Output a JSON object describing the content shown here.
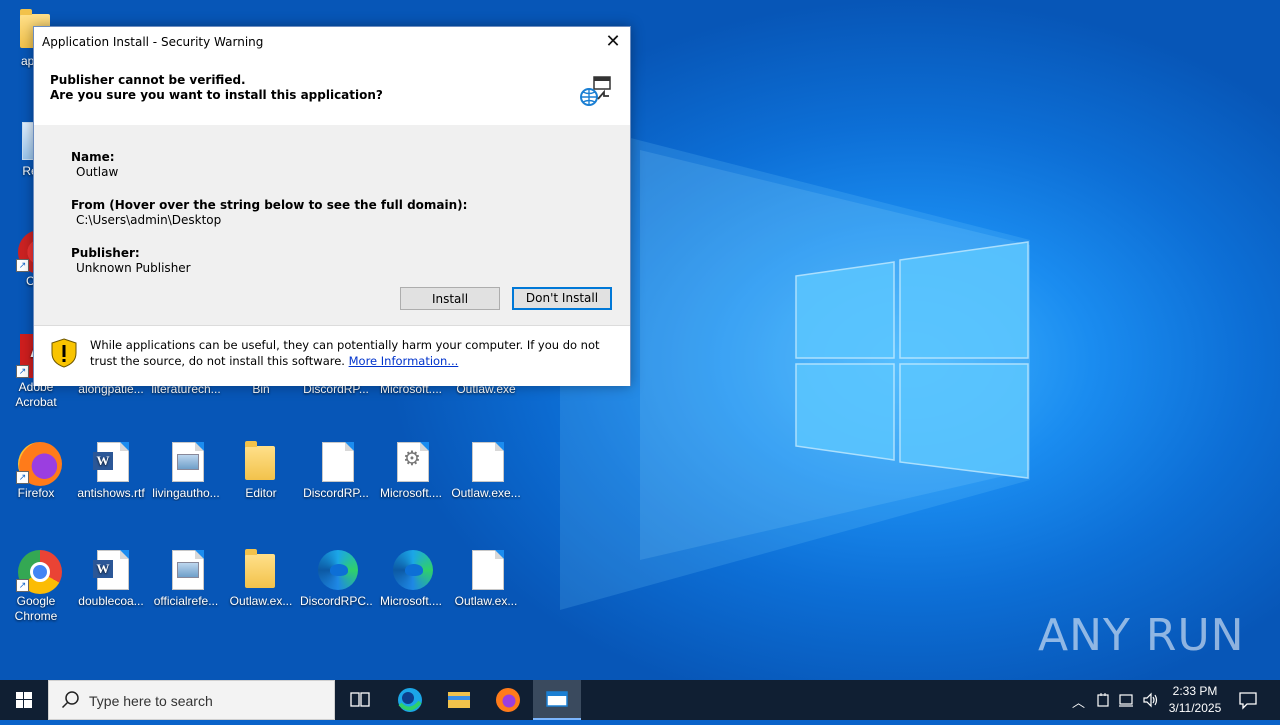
{
  "desktop": {
    "icons": [
      {
        "label": "app.p"
      },
      {
        "label": "Recy"
      },
      {
        "label": "CCl"
      },
      {
        "label": "Adobe Acrobat"
      },
      {
        "label": "alongpatie..."
      },
      {
        "label": "literaturech..."
      },
      {
        "label": "Bin"
      },
      {
        "label": "DiscordRP..."
      },
      {
        "label": "Microsoft...."
      },
      {
        "label": "Outlaw.exe"
      },
      {
        "label": "Firefox"
      },
      {
        "label": "antishows.rtf"
      },
      {
        "label": "livingautho..."
      },
      {
        "label": "Editor"
      },
      {
        "label": "DiscordRP..."
      },
      {
        "label": "Microsoft...."
      },
      {
        "label": "Outlaw.exe..."
      },
      {
        "label": "Google Chrome"
      },
      {
        "label": "doublecoa..."
      },
      {
        "label": "officialrefe..."
      },
      {
        "label": "Outlaw.ex..."
      },
      {
        "label": "DiscordRPC..."
      },
      {
        "label": "Microsoft...."
      },
      {
        "label": "Outlaw.ex..."
      }
    ],
    "watermark": "ANY RUN"
  },
  "dialog": {
    "title": "Application Install - Security Warning",
    "heading1": "Publisher cannot be verified.",
    "heading2": "Are you sure you want to install this application?",
    "name_label": "Name:",
    "name_value": "Outlaw",
    "from_label": "From (Hover over the string below to see the full domain):",
    "from_value": "C:\\Users\\admin\\Desktop",
    "publisher_label": "Publisher:",
    "publisher_value": "Unknown Publisher",
    "install_label": "Install",
    "dont_install_label": "Don't Install",
    "warning_text": "While applications can be useful, they can potentially harm your computer. If you do not trust the source, do not install this software.",
    "more_info": "More Information..."
  },
  "taskbar": {
    "search_placeholder": "Type here to search",
    "time": "2:33 PM",
    "date": "3/11/2025"
  },
  "colors": {
    "accent": "#0078d7",
    "taskbar": "#101f33",
    "wallpaper": "#0d6fd6"
  }
}
